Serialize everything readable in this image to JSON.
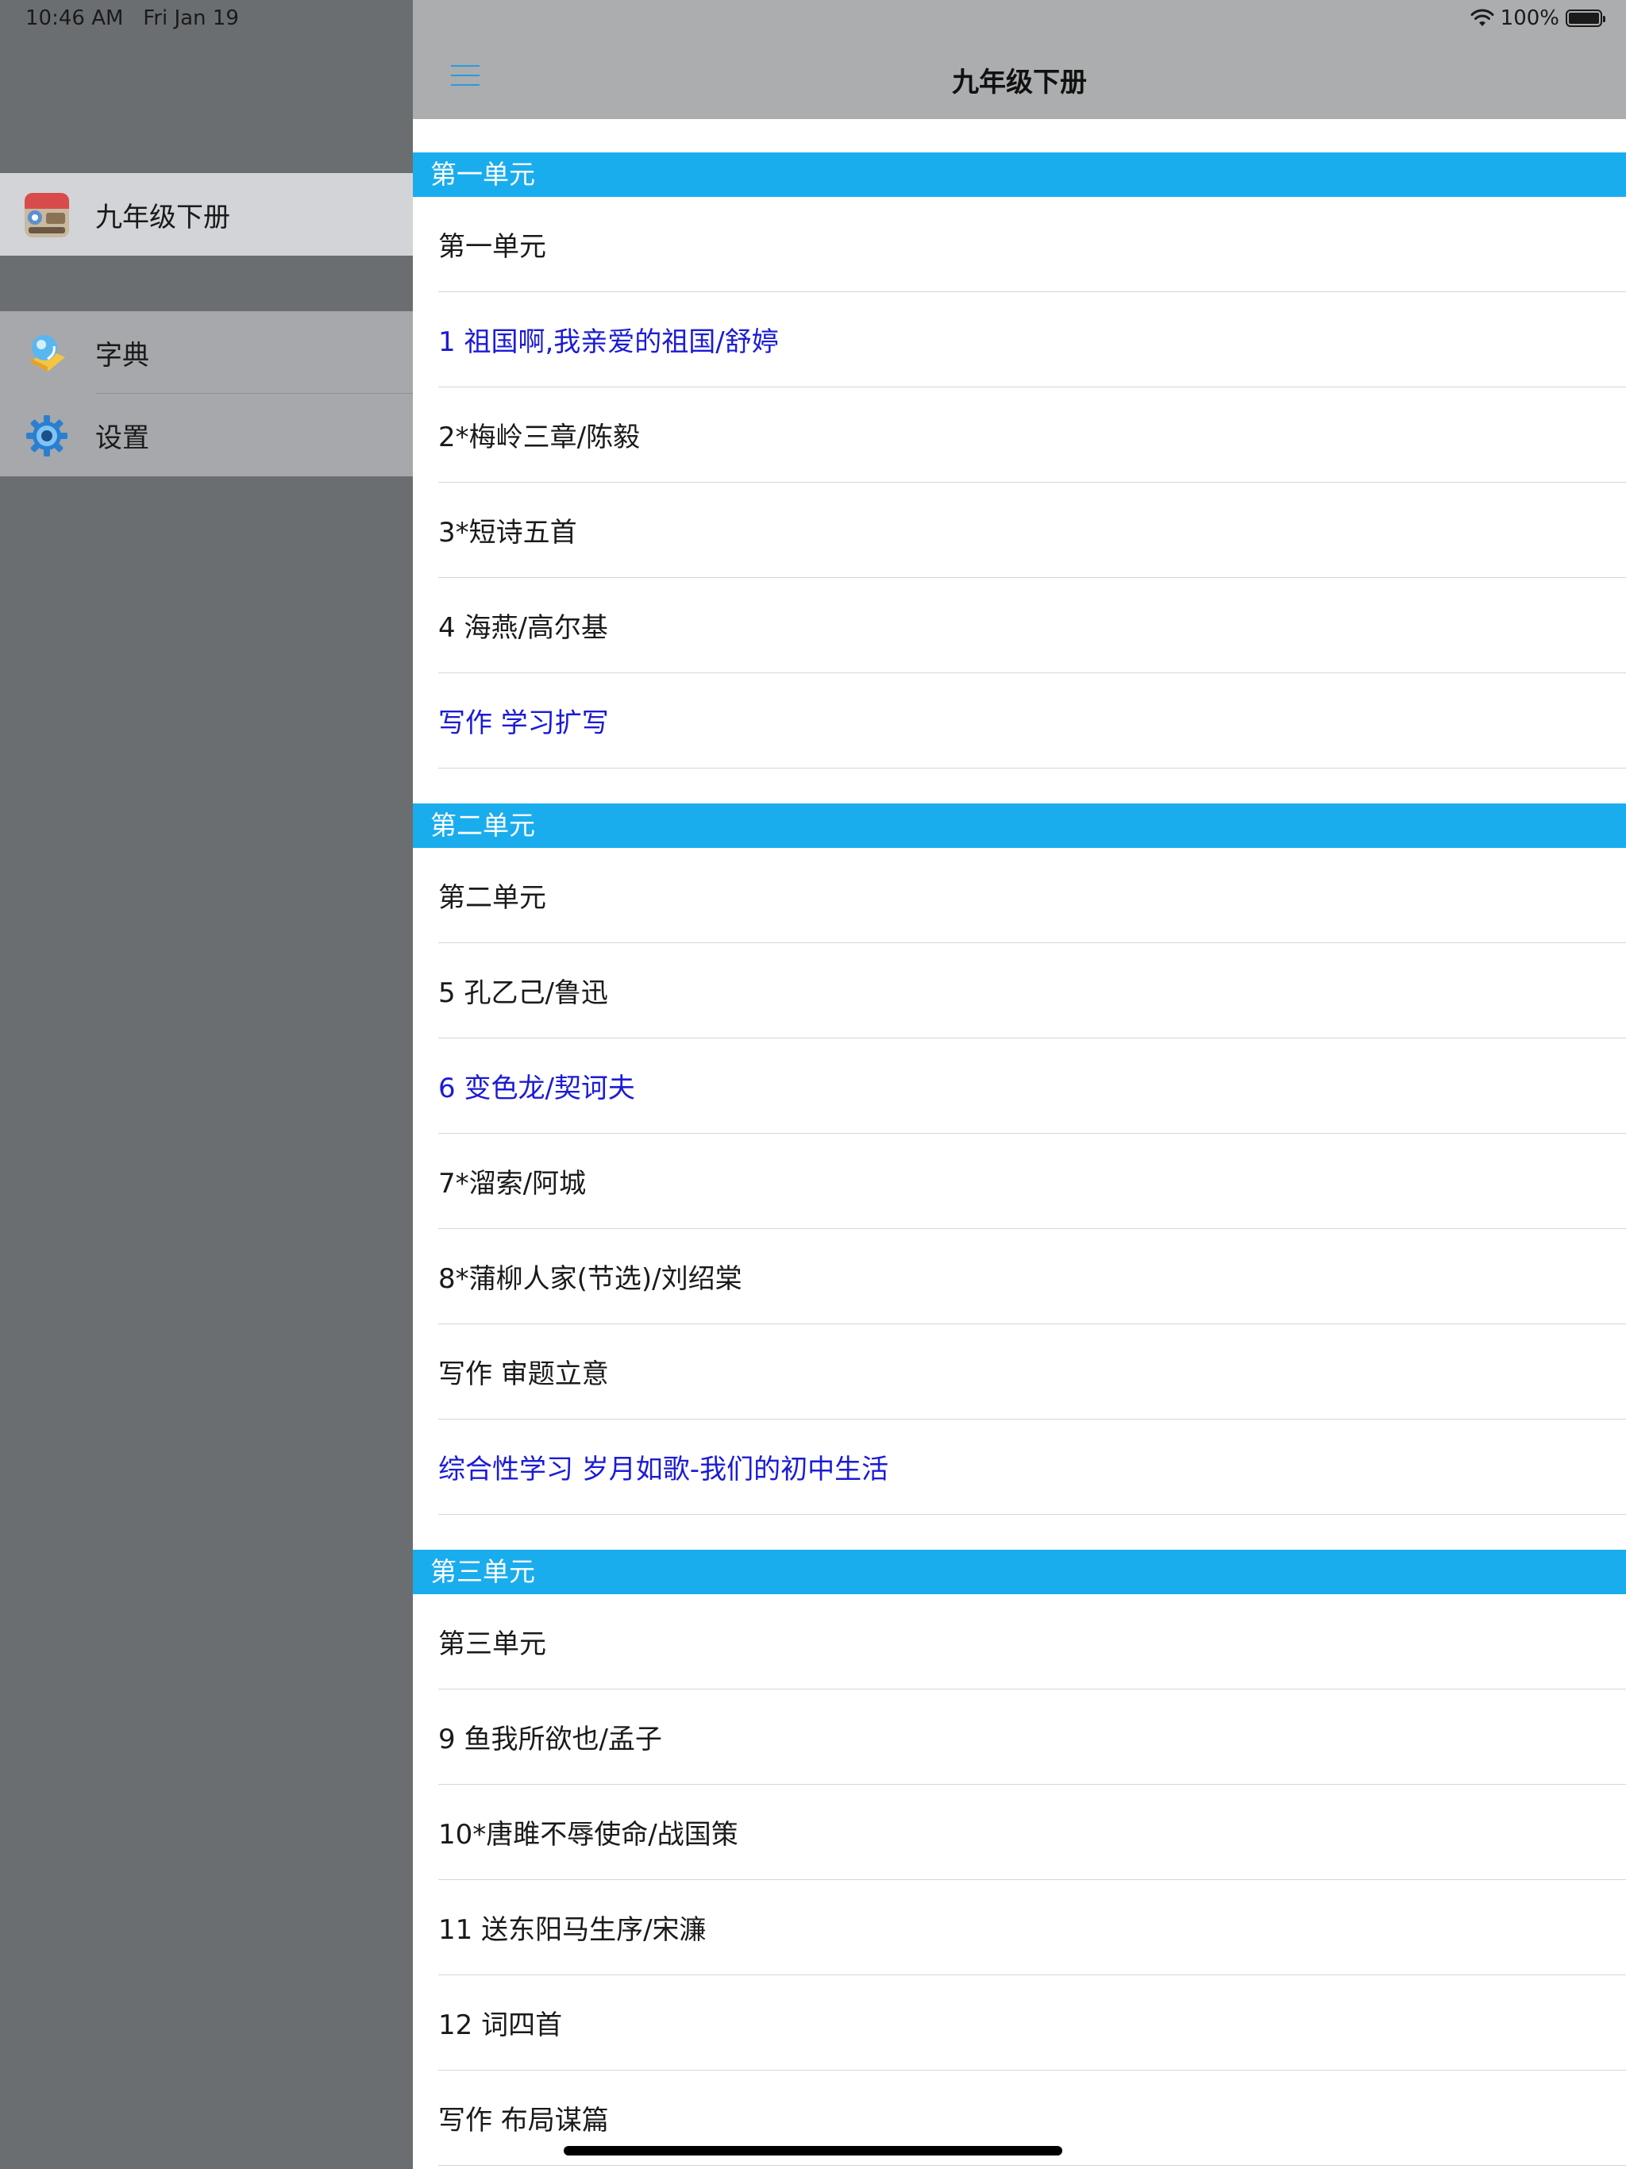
{
  "status_bar": {
    "time": "10:46 AM",
    "date": "Fri Jan 19",
    "battery": "100%",
    "battery_level": 1.0
  },
  "sidebar": {
    "items": [
      {
        "label": "九年级下册",
        "icon": "book-cover-icon",
        "selected": true
      },
      {
        "label": "字典",
        "icon": "dictionary-icon",
        "selected": false
      },
      {
        "label": "设置",
        "icon": "gear-icon",
        "selected": false
      }
    ]
  },
  "navbar": {
    "title": "九年级下册",
    "menu_icon": "hamburger-menu-icon"
  },
  "sections": [
    {
      "header": "第一单元",
      "rows": [
        {
          "label": "第一单元",
          "highlighted": false
        },
        {
          "label": "1 祖国啊,我亲爱的祖国/舒婷",
          "highlighted": true
        },
        {
          "label": "2*梅岭三章/陈毅",
          "highlighted": false
        },
        {
          "label": "3*短诗五首",
          "highlighted": false
        },
        {
          "label": "4 海燕/高尔基",
          "highlighted": false
        },
        {
          "label": "写作 学习扩写",
          "highlighted": true
        }
      ]
    },
    {
      "header": "第二单元",
      "rows": [
        {
          "label": "第二单元",
          "highlighted": false
        },
        {
          "label": "5 孔乙己/鲁迅",
          "highlighted": false
        },
        {
          "label": "6 变色龙/契诃夫",
          "highlighted": true
        },
        {
          "label": "7*溜索/阿城",
          "highlighted": false
        },
        {
          "label": "8*蒲柳人家(节选)/刘绍棠",
          "highlighted": false
        },
        {
          "label": "写作 审题立意",
          "highlighted": false
        },
        {
          "label": "综合性学习 岁月如歌-我们的初中生活",
          "highlighted": true
        }
      ]
    },
    {
      "header": "第三单元",
      "rows": [
        {
          "label": "第三单元",
          "highlighted": false
        },
        {
          "label": "9 鱼我所欲也/孟子",
          "highlighted": false
        },
        {
          "label": "10*唐雎不辱使命/战国策",
          "highlighted": false
        },
        {
          "label": "11 送东阳马生序/宋濂",
          "highlighted": false
        },
        {
          "label": "12 词四首",
          "highlighted": false
        },
        {
          "label": "写作 布局谋篇",
          "highlighted": false
        }
      ]
    }
  ],
  "colors": {
    "section_header": "#1aadee",
    "link_blue": "#1b1bd6",
    "accent_blue": "#2a9ae0"
  }
}
